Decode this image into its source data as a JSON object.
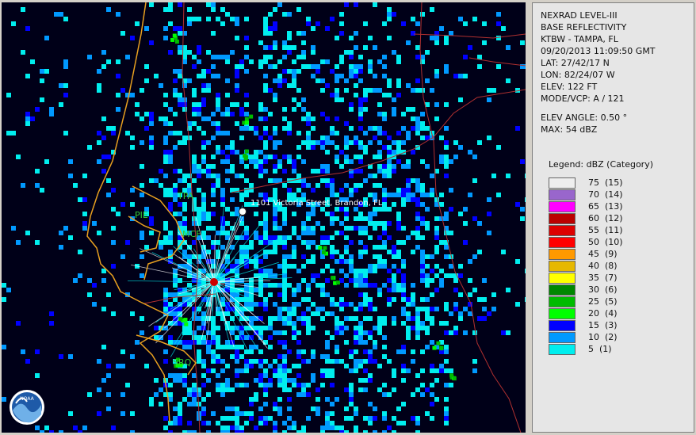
{
  "product": {
    "title_line1": "NEXRAD LEVEL-III",
    "title_line2": "BASE REFLECTIVITY",
    "station": "KTBW - TAMPA, FL",
    "datetime": "09/20/2013 11:09:50 GMT",
    "lat": "LAT: 27/42/17 N",
    "lon": "LON: 82/24/07 W",
    "elev": "ELEV: 122 FT",
    "mode": "MODE/VCP: A / 121",
    "elev_angle": "ELEV ANGLE: 0.50 °",
    "max": "MAX: 54 dBZ"
  },
  "legend": {
    "title": "Legend: dBZ (Category)",
    "items": [
      {
        "label": "75  (15)",
        "color": "#eeeeee"
      },
      {
        "label": "70  (14)",
        "color": "#9966cc"
      },
      {
        "label": "65  (13)",
        "color": "#ff00ff"
      },
      {
        "label": "60  (12)",
        "color": "#bb0000"
      },
      {
        "label": "55  (11)",
        "color": "#dd0000"
      },
      {
        "label": "50  (10)",
        "color": "#ff0000"
      },
      {
        "label": "45  (9)",
        "color": "#ff9900"
      },
      {
        "label": "40  (8)",
        "color": "#e6b800"
      },
      {
        "label": "35  (7)",
        "color": "#ffff00"
      },
      {
        "label": "30  (6)",
        "color": "#008800"
      },
      {
        "label": "25  (5)",
        "color": "#00bb00"
      },
      {
        "label": "20  (4)",
        "color": "#00ff00"
      },
      {
        "label": "15  (3)",
        "color": "#0000ff"
      },
      {
        "label": "10  (2)",
        "color": "#0099ff"
      },
      {
        "label": "5  (1)",
        "color": "#00eeee"
      }
    ]
  },
  "map": {
    "location_label": "1101 Victoria Street, Brandon, FL",
    "city_labels": [
      "TPA",
      "PIE",
      "MCF",
      "SRQ"
    ],
    "logo_text": "NOAA",
    "colors": {
      "background": "#000018",
      "coastline": "#e8a020",
      "county_lines": "#b03030"
    }
  }
}
